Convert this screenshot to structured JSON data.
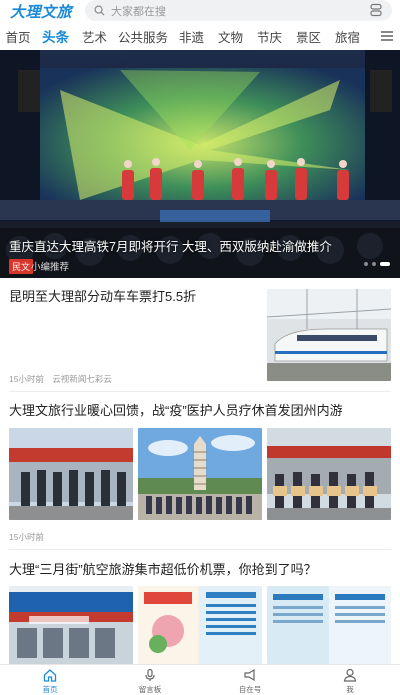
{
  "header": {
    "logo": "大理文旅",
    "search_placeholder": "大家都在搜"
  },
  "tabs": [
    "首页",
    "头条",
    "艺术",
    "公共服务",
    "非遗",
    "文物",
    "节庆",
    "景区",
    "旅宿"
  ],
  "active_tab": "头条",
  "hero": {
    "title": "重庆直达大理高铁7月即将开行 大理、西双版纳赴渝做推介",
    "tag": "民文",
    "source": "小编推荐"
  },
  "articles": [
    {
      "title": "昆明至大理部分动车车票打5.5折",
      "time": "15小时前",
      "source": "云视新闻七彩云"
    },
    {
      "title": "大理文旅行业暖心回馈，战“疫”医护人员疗休首发团州内游",
      "time": "15小时前",
      "source": ""
    },
    {
      "title": "大理“三月街”航空旅游集市超低价机票，你抢到了吗？",
      "time": "",
      "source": ""
    }
  ],
  "bottom_nav": [
    {
      "label": "首页",
      "icon": "home-icon",
      "active": true
    },
    {
      "label": "留言板",
      "icon": "mic-icon",
      "active": false
    },
    {
      "label": "自在号",
      "icon": "megaphone-icon",
      "active": false
    },
    {
      "label": "我",
      "icon": "user-icon",
      "active": false
    }
  ],
  "colors": {
    "accent": "#1a8ad8",
    "tag_red": "#d9352b"
  }
}
